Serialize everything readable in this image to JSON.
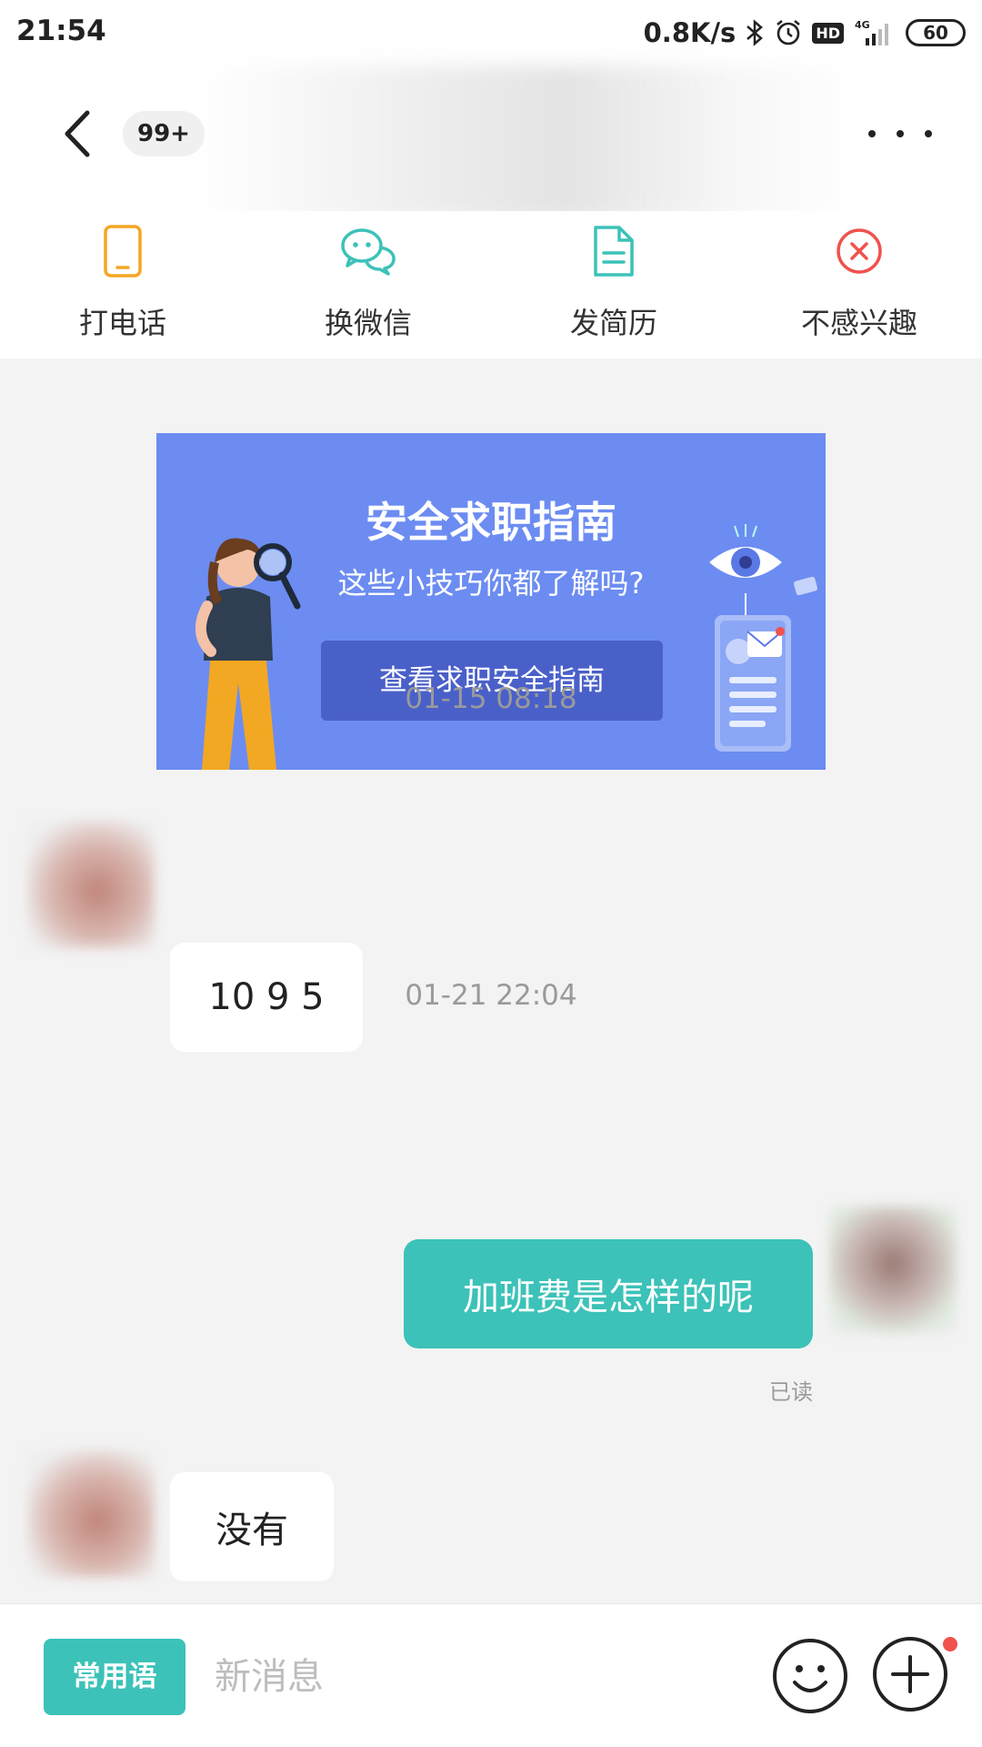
{
  "status_bar": {
    "time": "21:54",
    "net_speed": "0.8K/s",
    "hd_label": "HD",
    "network": "4G",
    "battery": "60"
  },
  "header": {
    "unread_count": "99+"
  },
  "actions": [
    {
      "label": "打电话",
      "icon": "phone-icon",
      "color": "#f5a623"
    },
    {
      "label": "换微信",
      "icon": "wechat-icon",
      "color": "#3cc2b8"
    },
    {
      "label": "发简历",
      "icon": "resume-icon",
      "color": "#3cc2b8"
    },
    {
      "label": "不感兴趣",
      "icon": "not-interested-icon",
      "color": "#f0524d"
    }
  ],
  "banner": {
    "title": "安全求职指南",
    "subtitle": "这些小技巧你都了解吗?",
    "button": "查看求职安全指南"
  },
  "messages": {
    "timestamp_1": "01-15 08:18",
    "msg_1": "10 9 5",
    "timestamp_2": "01-21 22:04",
    "msg_2": "加班费是怎样的呢",
    "msg_2_status": "已读",
    "msg_3": "没有"
  },
  "composer": {
    "phrases_button": "常用语",
    "placeholder": "新消息"
  },
  "colors": {
    "accent": "#3cc2b8",
    "banner_bg": "#6c8cf2",
    "alert": "#f0524d"
  }
}
